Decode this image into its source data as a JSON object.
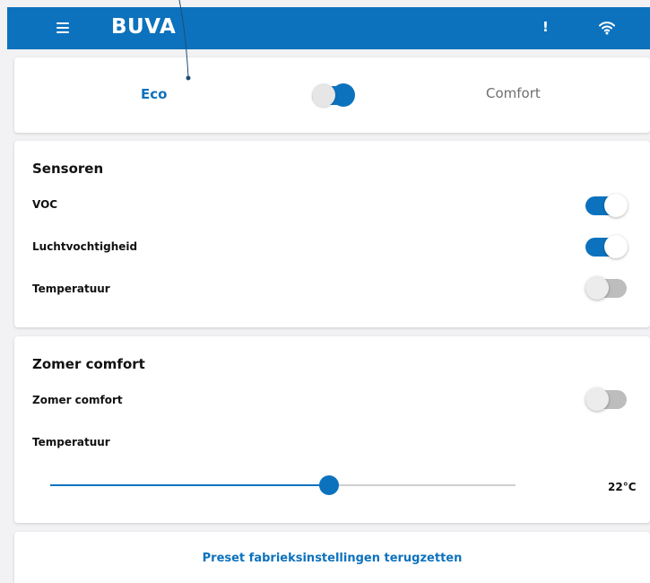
{
  "header": {
    "brand": "BUVA",
    "alert_glyph": "!",
    "icons": [
      "menu-icon",
      "alert-icon",
      "wifi-icon"
    ],
    "accent_color": "#0d72bd"
  },
  "mode": {
    "eco_label": "Eco",
    "comfort_label": "Comfort",
    "selected": "Eco"
  },
  "sensors": {
    "title": "Sensoren",
    "items": [
      {
        "label": "VOC",
        "enabled": true
      },
      {
        "label": "Luchtvochtigheid",
        "enabled": true
      },
      {
        "label": "Temperatuur",
        "enabled": false
      }
    ]
  },
  "summer": {
    "title": "Zomer comfort",
    "toggle_label": "Zomer comfort",
    "toggle_enabled": false,
    "temperature_label": "Temperatuur",
    "slider_fraction": 0.6,
    "temperature_value": "22°C"
  },
  "reset": {
    "label": "Preset fabrieksinstellingen terugzetten"
  }
}
